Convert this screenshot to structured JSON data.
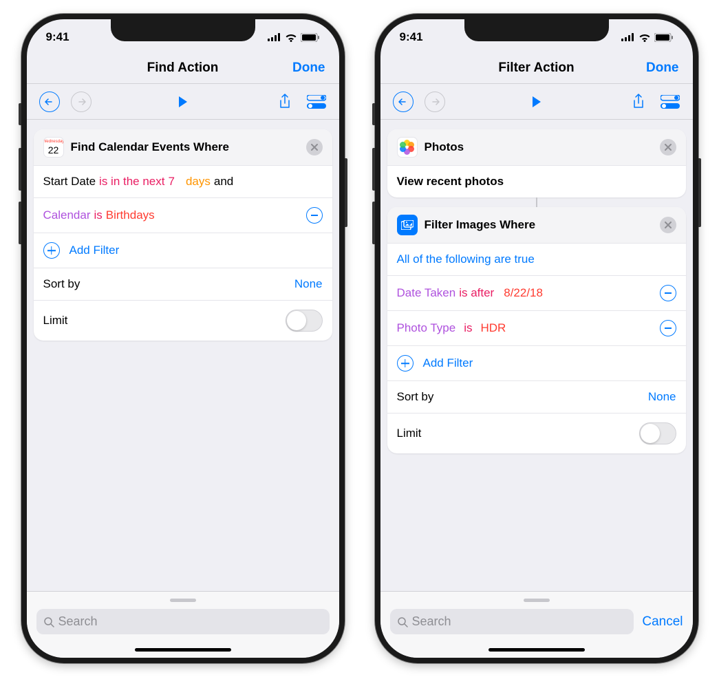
{
  "status": {
    "time": "9:41"
  },
  "left": {
    "nav": {
      "title": "Find Action",
      "done": "Done"
    },
    "card": {
      "title": "Find Calendar Events Where",
      "icon_day": "22",
      "icon_weekday": "Wednesday",
      "filter1": {
        "field": "Start Date",
        "op": "is in the next",
        "value": "7",
        "unit": "days",
        "conj": "and"
      },
      "filter2": {
        "field": "Calendar",
        "op": "is",
        "value": "Birthdays"
      },
      "add_filter": "Add Filter",
      "sort_label": "Sort by",
      "sort_value": "None",
      "limit_label": "Limit"
    },
    "search": {
      "placeholder": "Search"
    }
  },
  "right": {
    "nav": {
      "title": "Filter Action",
      "done": "Done"
    },
    "photos_card": {
      "title": "Photos",
      "subtitle": "View recent photos"
    },
    "filter_card": {
      "title": "Filter Images Where",
      "condition_header": "All of the following are true",
      "filter1": {
        "field": "Date Taken",
        "op": "is after",
        "value": "8/22/18"
      },
      "filter2": {
        "field": "Photo Type",
        "op": "is",
        "value": "HDR"
      },
      "add_filter": "Add Filter",
      "sort_label": "Sort by",
      "sort_value": "None",
      "limit_label": "Limit"
    },
    "search": {
      "placeholder": "Search",
      "cancel": "Cancel"
    }
  }
}
